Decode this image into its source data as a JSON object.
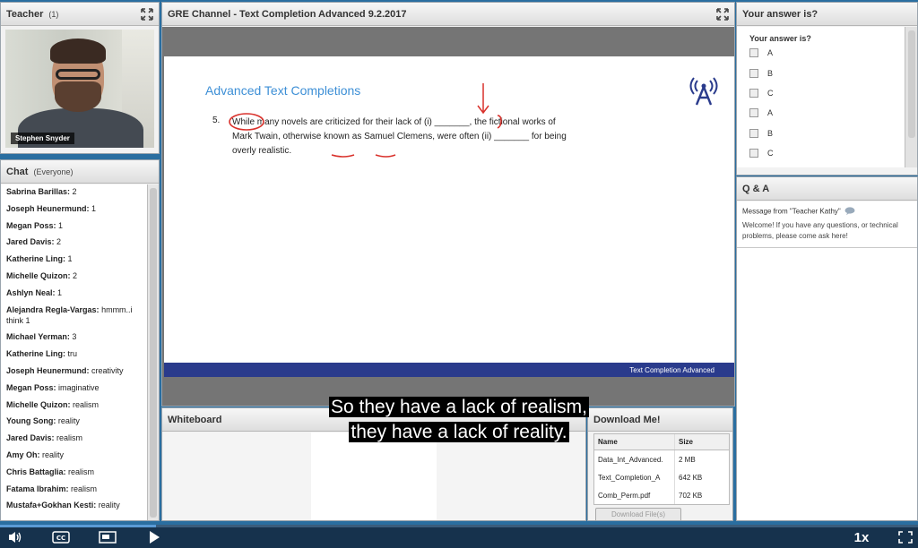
{
  "teacher": {
    "title": "Teacher",
    "count": "(1)",
    "name_caption": "Stephen Snyder"
  },
  "chat": {
    "title": "Chat",
    "scope": "(Everyone)",
    "messages": [
      {
        "name": "Sabrina Barillas:",
        "text": "2"
      },
      {
        "name": "Joseph Heunermund:",
        "text": "1"
      },
      {
        "name": "Megan Poss:",
        "text": "1"
      },
      {
        "name": "Jared Davis:",
        "text": "2"
      },
      {
        "name": "Katherine Ling:",
        "text": "1"
      },
      {
        "name": "Michelle Quizon:",
        "text": "2"
      },
      {
        "name": "Ashlyn Neal:",
        "text": "1"
      },
      {
        "name": "Alejandra Regla-Vargas:",
        "text": "hmmm..i think 1"
      },
      {
        "name": "Michael Yerman:",
        "text": "3"
      },
      {
        "name": "Katherine Ling:",
        "text": "tru"
      },
      {
        "name": "Joseph Heunermund:",
        "text": "creativity"
      },
      {
        "name": "Megan Poss:",
        "text": "imaginative"
      },
      {
        "name": "Michelle Quizon:",
        "text": "realism"
      },
      {
        "name": "Young Song:",
        "text": "reality"
      },
      {
        "name": "Jared Davis:",
        "text": "realism"
      },
      {
        "name": "Amy Oh:",
        "text": "reality"
      },
      {
        "name": "Chris Battaglia:",
        "text": "realism"
      },
      {
        "name": "Fatama Ibrahim:",
        "text": "realism"
      },
      {
        "name": "Mustafa+Gokhan Kesti:",
        "text": "reality"
      }
    ]
  },
  "share": {
    "title": "GRE Channel - Text Completion Advanced 9.2.2017",
    "slide_title": "Advanced Text Completions",
    "question_number": "5.",
    "question_text": "While many novels are criticized for their lack of (i) _______, the fictional works of Mark Twain, otherwise known as Samuel Clemens, were often (ii) _______ for being overly realistic.",
    "footer": "Text Completion Advanced"
  },
  "answer": {
    "title": "Your answer is?",
    "question": "Your answer is?",
    "options": [
      "A",
      "B",
      "C",
      "A",
      "B",
      "C"
    ]
  },
  "qa": {
    "title": "Q & A",
    "from": "Message from \"Teacher Kathy\"",
    "message": "Welcome! If you have any questions, or technical problems, please come ask here!"
  },
  "whiteboard": {
    "title": "Whiteboard"
  },
  "download": {
    "title": "Download Me!",
    "col_name": "Name",
    "col_size": "Size",
    "files": [
      {
        "name": "Data_Int_Advanced.",
        "size": "2 MB"
      },
      {
        "name": "Text_Completion_A",
        "size": "642 KB"
      },
      {
        "name": "Comb_Perm.pdf",
        "size": "702 KB"
      }
    ],
    "button": "Download File(s)"
  },
  "subtitle": {
    "line1": "So they have a lack of realism,",
    "line2": "they have a lack of reality."
  },
  "player": {
    "speed": "1x",
    "progress": 0.17
  },
  "colors": {
    "slide_title": "#3d8fd6",
    "footer_bar": "#2a3b8c",
    "annotation_red": "#d9312b",
    "player_bg": "#16324d"
  }
}
